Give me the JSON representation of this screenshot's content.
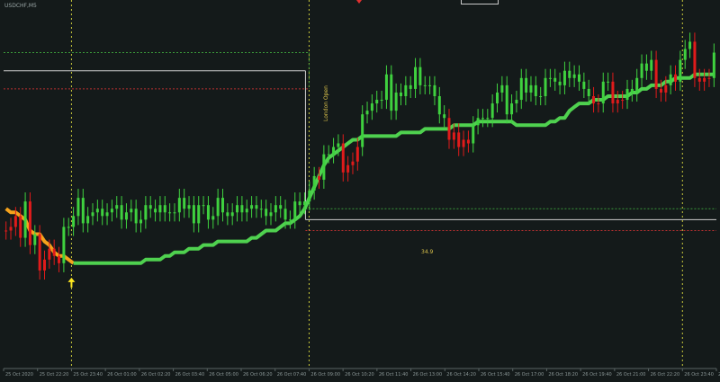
{
  "symbol": "USDCHF,M5",
  "annotations": {
    "session_label": "London Open",
    "value_label": "34.9"
  },
  "colors": {
    "background": "#141a1a",
    "bull_candle": "#3fd13f",
    "bear_candle": "#e01b1b",
    "ma_line_past": "#f5a21c",
    "ma_line": "#4fd14f",
    "range_high": "#cfcfcf",
    "range_top_dotted": "#3a9a3a",
    "range_low_dotted": "#b83030",
    "vertical_dotted": "#c9c93a",
    "arrow": "#ffe820"
  },
  "chart_data": {
    "type": "candlestick",
    "title": "",
    "xlabel": "",
    "ylabel": "",
    "ylim": [
      0,
      100
    ],
    "grid": false,
    "x_ticks": [
      "25 Oct 2020",
      "25 Oct 22:20",
      "25 Oct 23:40",
      "26 Oct 01:00",
      "26 Oct 02:20",
      "26 Oct 03:40",
      "26 Oct 05:00",
      "26 Oct 06:20",
      "26 Oct 07:40",
      "26 Oct 09:00",
      "26 Oct 10:20",
      "26 Oct 11:40",
      "26 Oct 13:00",
      "26 Oct 14:20",
      "26 Oct 15:40",
      "26 Oct 17:00",
      "26 Oct 18:20",
      "26 Oct 19:40",
      "26 Oct 21:00",
      "26 Oct 22:20",
      "26 Oct 23:40",
      "27 Oct"
    ],
    "series": [
      {
        "values": [
          38,
          39,
          42,
          36,
          46,
          34,
          37,
          27,
          30,
          33,
          31,
          29,
          39,
          39,
          42,
          47,
          40,
          42,
          43,
          44,
          42,
          43,
          44,
          45,
          41,
          43,
          44,
          40,
          41,
          45,
          44,
          43,
          45,
          43,
          43,
          43,
          47,
          44,
          45,
          40,
          45,
          45,
          41,
          42,
          47,
          43,
          42,
          43,
          45,
          43,
          44,
          45,
          44,
          44,
          42,
          43,
          45,
          44,
          41,
          41,
          46,
          45,
          46,
          49,
          53,
          52,
          59,
          59,
          61,
          62,
          54,
          56,
          57,
          61,
          70,
          71,
          73,
          74,
          74,
          81,
          71,
          76,
          75,
          78,
          77,
          83,
          78,
          78,
          78,
          75,
          70,
          69,
          63,
          65,
          61,
          63,
          62,
          67,
          69,
          69,
          69,
          73,
          76,
          78,
          70,
          73,
          74,
          80,
          76,
          78,
          75,
          75,
          80,
          80,
          79,
          78,
          82,
          80,
          81,
          79,
          77,
          75,
          73,
          73,
          79,
          79,
          73,
          74,
          74,
          77,
          76,
          80,
          84,
          82,
          85,
          77,
          76,
          78,
          81,
          79,
          85,
          88,
          90,
          80,
          79,
          80,
          80,
          87
        ]
      },
      {
        "values": [
          44,
          43,
          43,
          42,
          41,
          38,
          37,
          37,
          35,
          34,
          32,
          31,
          31,
          30,
          29,
          29,
          29,
          29,
          29,
          29,
          29,
          29,
          29,
          29,
          29,
          29,
          29,
          29,
          29,
          30,
          30,
          30,
          30,
          31,
          31,
          32,
          32,
          32,
          33,
          33,
          33,
          34,
          34,
          34,
          35,
          35,
          35,
          35,
          35,
          35,
          35,
          36,
          36,
          37,
          38,
          38,
          38,
          39,
          40,
          40,
          41,
          42,
          44,
          47,
          50,
          53,
          56,
          58,
          59,
          60,
          61,
          62,
          63,
          63,
          64,
          64,
          64,
          64,
          64,
          64,
          64,
          64,
          65,
          65,
          65,
          65,
          65,
          66,
          66,
          66,
          66,
          66,
          66,
          67,
          67,
          67,
          67,
          67,
          68,
          68,
          68,
          68,
          68,
          68,
          68,
          68,
          67,
          67,
          67,
          67,
          67,
          67,
          67,
          68,
          68,
          69,
          69,
          71,
          72,
          73,
          73,
          73,
          74,
          74,
          74,
          75,
          75,
          75,
          75,
          75,
          76,
          76,
          77,
          77,
          78,
          78,
          78,
          79,
          79,
          80,
          80,
          80,
          80,
          81,
          81,
          81,
          81,
          81
        ]
      }
    ],
    "horizontal_levels": [
      {
        "value": 87
      },
      {
        "value": 82
      },
      {
        "value": 77
      },
      {
        "value": 44
      },
      {
        "value": 41
      },
      {
        "value": 38
      }
    ],
    "vertical_markers": [
      "25 Oct 23:40",
      "26 Oct 09:00",
      "26 Oct 23:40"
    ],
    "signal_arrow": {
      "x": "25 Oct 23:40",
      "direction": "up"
    }
  }
}
